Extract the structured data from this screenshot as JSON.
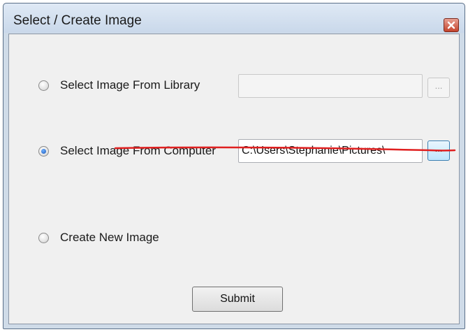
{
  "window": {
    "title": "Select / Create Image",
    "close_icon": "close-icon"
  },
  "options": {
    "library": {
      "label": "Select Image From Library",
      "selected": false,
      "path_value": "",
      "browse_label": "..."
    },
    "computer": {
      "label": "Select Image From Computer",
      "selected": true,
      "path_value": "C:\\Users\\Stephanie\\Pictures\\",
      "browse_label": "..."
    },
    "create_new": {
      "label": "Create New Image",
      "selected": false
    }
  },
  "actions": {
    "submit_label": "Submit"
  },
  "colors": {
    "annotation_underline": "#e02020",
    "selected_radio": "#1a56b8"
  }
}
